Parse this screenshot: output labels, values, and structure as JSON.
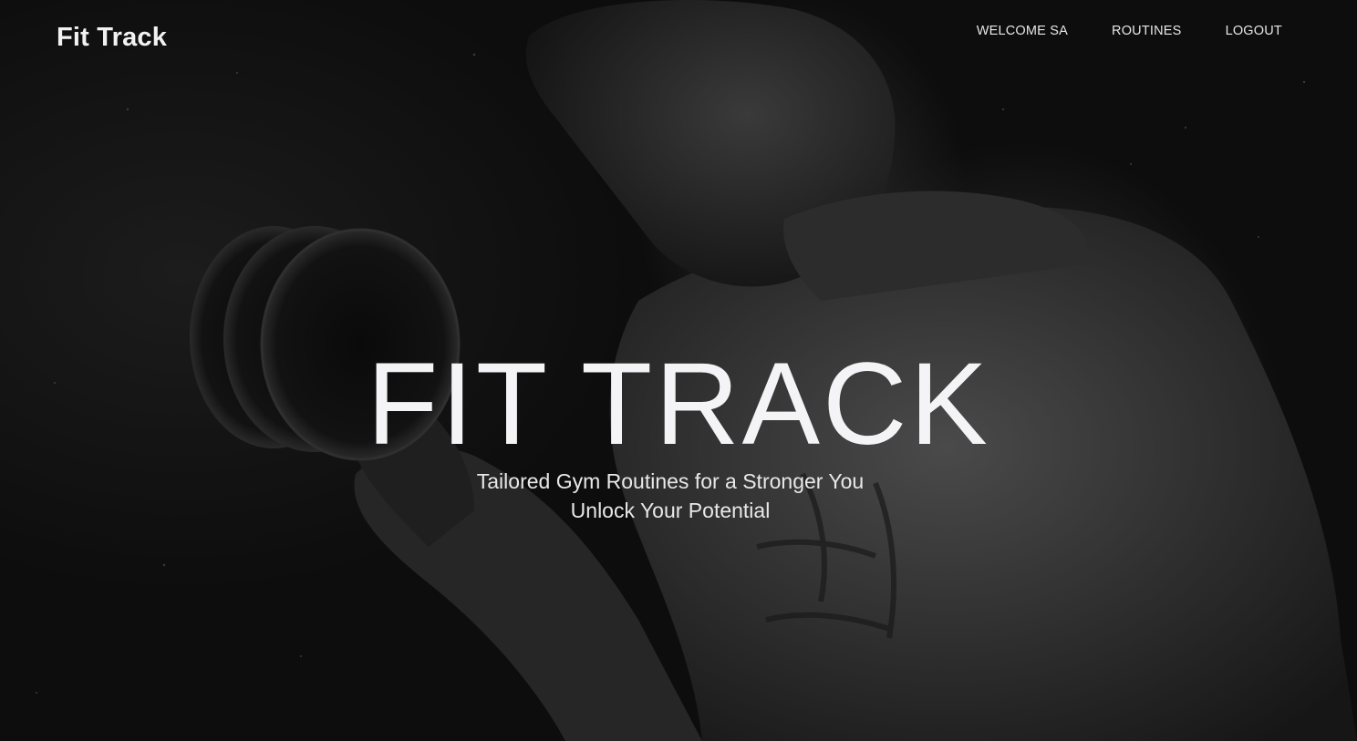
{
  "navbar": {
    "brand": "Fit Track",
    "links": [
      {
        "label": "WELCOME SA"
      },
      {
        "label": "ROUTINES"
      },
      {
        "label": "LOGOUT"
      }
    ]
  },
  "hero": {
    "title": "FIT TRACK",
    "subtitle_line1": "Tailored Gym Routines for a Stronger You",
    "subtitle_line2": "Unlock Your Potential",
    "background_image": "monochrome photo of a shirtless man curling a dumbbell"
  },
  "colors": {
    "background": "#0d0d0d",
    "text": "#f4f4f6"
  }
}
